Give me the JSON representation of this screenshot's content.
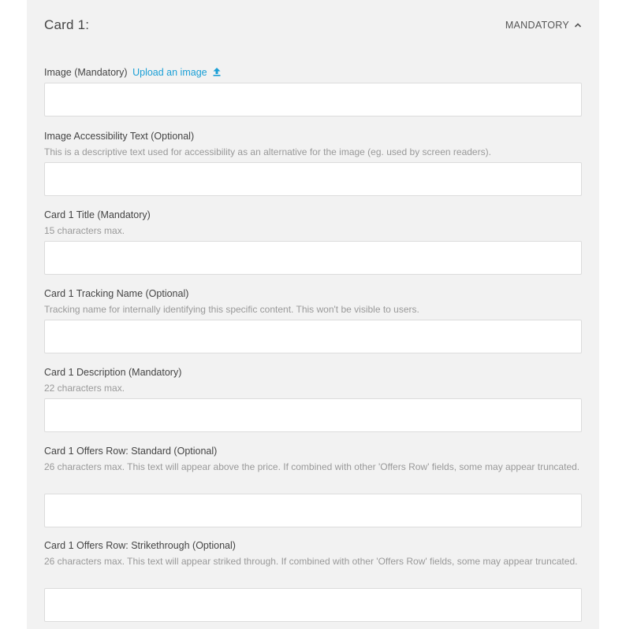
{
  "card": {
    "title": "Card 1:",
    "toggle_label": "MANDATORY",
    "toggle_icon": "chevron-up-icon"
  },
  "fields": {
    "image": {
      "label": "Image (Mandatory)",
      "upload_link": "Upload an image",
      "upload_icon": "upload-icon",
      "value": ""
    },
    "alt_text": {
      "label": "Image Accessibility Text (Optional)",
      "help": "This is a descriptive text used for accessibility as an alternative for the image (eg. used by screen readers).",
      "value": ""
    },
    "title": {
      "label": "Card 1 Title (Mandatory)",
      "help": "15 characters max.",
      "value": ""
    },
    "tracking": {
      "label": "Card 1 Tracking Name (Optional)",
      "help": "Tracking name for internally identifying this specific content. This won't be visible to users.",
      "value": ""
    },
    "description": {
      "label": "Card 1 Description (Mandatory)",
      "help": "22 characters max.",
      "value": ""
    },
    "offers_standard": {
      "label": "Card 1 Offers Row: Standard (Optional)",
      "help": "26 characters max. This text will appear above the price. If combined with other 'Offers Row' fields, some may appear truncated.",
      "value": ""
    },
    "offers_strike": {
      "label": "Card 1 Offers Row: Strikethrough (Optional)",
      "help": "26 characters max. This text will appear striked through. If combined with other 'Offers Row' fields, some may appear truncated.",
      "value": ""
    }
  },
  "colors": {
    "panel_bg": "#f2f2f2",
    "link": "#1a9fd6",
    "help_text": "#999999",
    "input_border": "#dcdcdc"
  }
}
